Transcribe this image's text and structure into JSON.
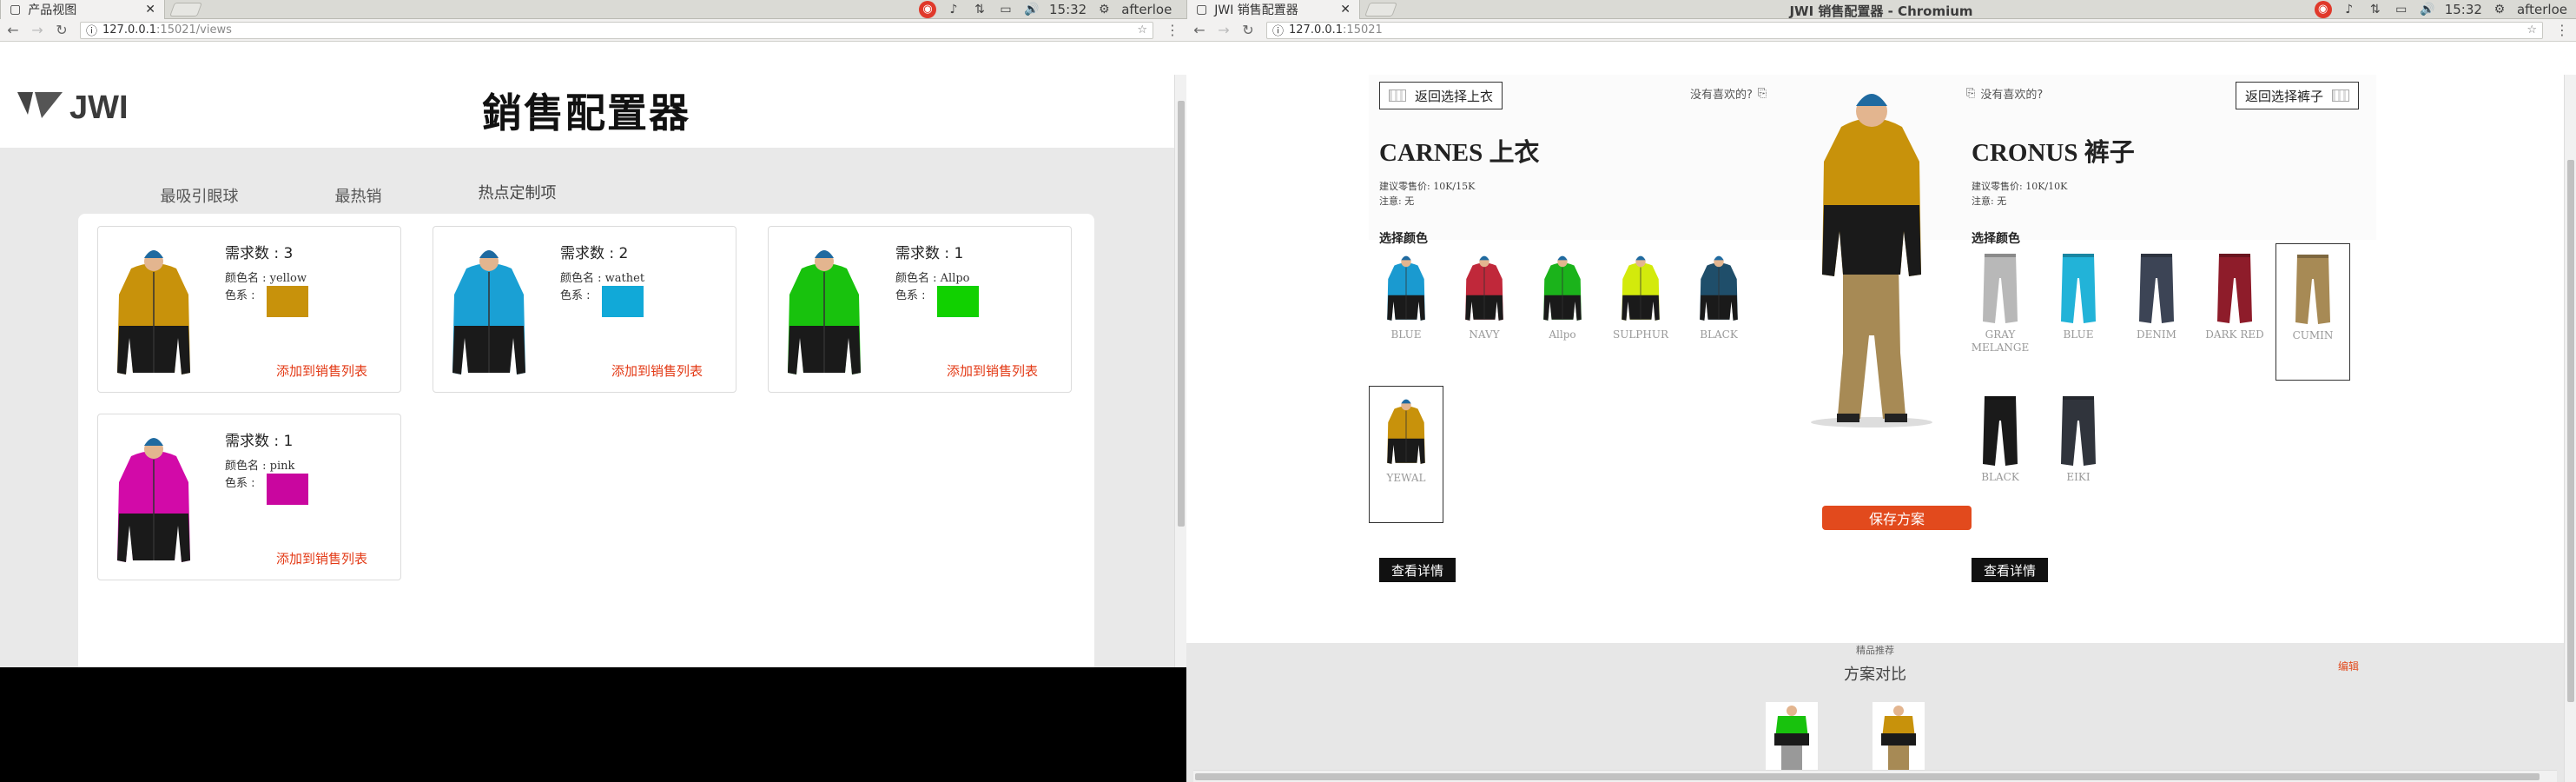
{
  "left_window": {
    "tab_title": "产品视图",
    "tray": {
      "user": "afterloe",
      "time": "15:32"
    },
    "url": {
      "host": "127.0.0.1",
      "port_path": ":15021/views"
    },
    "page": {
      "logo_text": "JWI",
      "title": "銷售配置器",
      "tabs": [
        {
          "label": "最吸引眼球"
        },
        {
          "label": "最热销"
        },
        {
          "label": "热点定制项",
          "active": true
        }
      ],
      "cards": [
        {
          "demand": "需求数 : 3",
          "color_name": "颜色名 : yellow",
          "color_label": "色系 :",
          "swatch": "#c8920b",
          "jacket": "#c8920b",
          "add": "添加到销售列表"
        },
        {
          "demand": "需求数 : 2",
          "color_name": "颜色名 : wathet",
          "color_label": "色系 :",
          "swatch": "#11a9d8",
          "jacket": "#1aa0d4",
          "add": "添加到销售列表"
        },
        {
          "demand": "需求数 : 1",
          "color_name": "颜色名 : Allpo",
          "color_label": "色系 :",
          "swatch": "#11d100",
          "jacket": "#18c20d",
          "add": "添加到销售列表"
        },
        {
          "demand": "需求数 : 1",
          "color_name": "颜色名 : pink",
          "color_label": "色系 :",
          "swatch": "#c9069f",
          "jacket": "#d20aa8",
          "add": "添加到销售列表"
        }
      ]
    }
  },
  "right_window": {
    "window_title": "JWI 销售配置器 - Chromium",
    "tab_title": "JWI 销售配置器",
    "tray": {
      "user": "afterloe",
      "time": "15:32"
    },
    "url": {
      "host": "127.0.0.1",
      "port_path": ":15021"
    },
    "top_section": {
      "back_label": "返回选择上衣",
      "no_like": "没有喜欢的?",
      "title": "CARNES 上衣",
      "price": "建议零售价: 10K/15K",
      "note": "注意: 无",
      "choose_color": "选择颜色",
      "options": [
        {
          "name": "BLUE",
          "color": "#1a9ad0"
        },
        {
          "name": "NAVY",
          "color": "#c0283a"
        },
        {
          "name": "Allpo",
          "color": "#1bb31b"
        },
        {
          "name": "SULPHUR",
          "color": "#d3ea0c"
        },
        {
          "name": "BLACK",
          "color": "#1f4e6a"
        },
        {
          "name": "YEWAL",
          "color": "#c8920b",
          "selected": true
        }
      ],
      "detail_button": "查看详情"
    },
    "bottom_section": {
      "back_label": "返回选择裤子",
      "no_like": "没有喜欢的?",
      "title": "CRONUS 裤子",
      "price": "建议零售价: 10K/10K",
      "note": "注意: 无",
      "choose_color": "选择颜色",
      "options": [
        {
          "name": "GRAY MELANGE",
          "color": "#b8b8b8"
        },
        {
          "name": "BLUE",
          "color": "#22b3d8"
        },
        {
          "name": "DENIM",
          "color": "#3c4455"
        },
        {
          "name": "DARK RED",
          "color": "#8e1c2a"
        },
        {
          "name": "CUMIN",
          "color": "#a78a55",
          "selected": true
        },
        {
          "name": "BLACK",
          "color": "#1a1a1a"
        },
        {
          "name": "EIKI",
          "color": "#30343c"
        }
      ],
      "detail_button": "查看详情"
    },
    "save_button": "保存方案",
    "footer": {
      "recommend": "精品推荐",
      "compare_title": "方案对比",
      "edit": "编辑"
    }
  }
}
